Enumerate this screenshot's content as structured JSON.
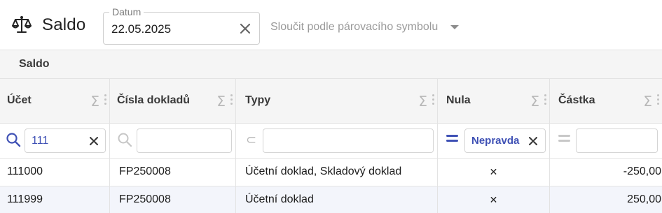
{
  "app": {
    "title": "Saldo",
    "icon": "scale-icon"
  },
  "date_filter": {
    "legend": "Datum",
    "value": "22.05.2025"
  },
  "merge_select": {
    "label": "Sloučit podle párovacího symbolu"
  },
  "section": {
    "title": "Saldo"
  },
  "columns": [
    {
      "label": "Účet",
      "filter_icon": "search-icon",
      "filter_value": "111"
    },
    {
      "label": "Čísla dokladů",
      "filter_icon": "search-icon",
      "filter_value": ""
    },
    {
      "label": "Typy",
      "filter_icon": "subset-icon",
      "filter_value": ""
    },
    {
      "label": "Nula",
      "filter_icon": "equals-icon",
      "filter_value": "Nepravda"
    },
    {
      "label": "Částka",
      "filter_icon": "equals-icon",
      "filter_value": ""
    }
  ],
  "aggregate_symbol": "Σ",
  "subset_symbol": "⊂",
  "rows": [
    {
      "ucet": "111000",
      "cisla": "FP250008",
      "typy": "Účetní doklad, Skladový doklad",
      "nula": "✕",
      "castka": "-250,00"
    },
    {
      "ucet": "111999",
      "cisla": "FP250008",
      "typy": "Účetní doklad",
      "nula": "✕",
      "castka": "250,00"
    }
  ],
  "colors": {
    "accent": "#3f51b5",
    "header_bg": "#f5f5f5",
    "alt_row_bg": "#f3f5fb"
  }
}
